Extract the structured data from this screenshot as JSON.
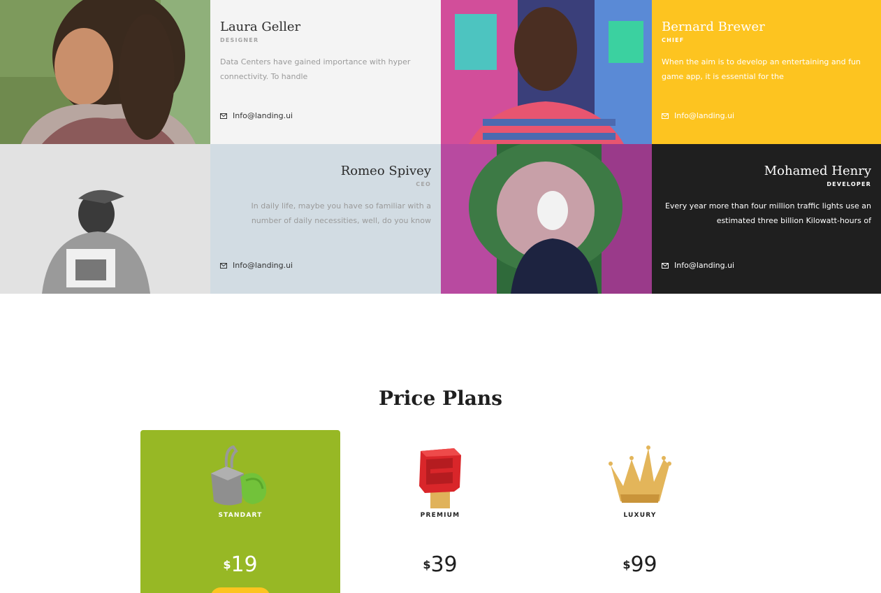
{
  "team": [
    {
      "name": "Laura Geller",
      "role": "DESIGNER",
      "bio": "Data Centers have gained importance with hyper connectivity. To handle",
      "email": "Info@landing.ui"
    },
    {
      "name": "Bernard Brewer",
      "role": "CHIEF",
      "bio": "When the aim is to develop an entertaining and fun game app, it is essential for the",
      "email": "Info@landing.ui"
    },
    {
      "name": "Romeo Spivey",
      "role": "CEO",
      "bio": "In daily life, maybe you have so familiar with a number of daily necessities, well, do you know",
      "email": "Info@landing.ui"
    },
    {
      "name": "Mohamed Henry",
      "role": "DEVELOPER",
      "bio": "Every year more than four million traffic lights use an estimated three billion Kilowatt-hours of",
      "email": "Info@landing.ui"
    }
  ],
  "pricing": {
    "title": "Price Plans",
    "currency": "$",
    "plans": [
      {
        "name": "STANDART",
        "price": "19",
        "icon": "bucket-icon"
      },
      {
        "name": "PREMIUM",
        "price": "39",
        "icon": "red-block-icon"
      },
      {
        "name": "LUXURY",
        "price": "99",
        "icon": "crown-icon"
      }
    ]
  },
  "colors": {
    "accent_yellow": "#fdc420",
    "accent_green": "#97b825",
    "dark": "#1f1f1f"
  }
}
